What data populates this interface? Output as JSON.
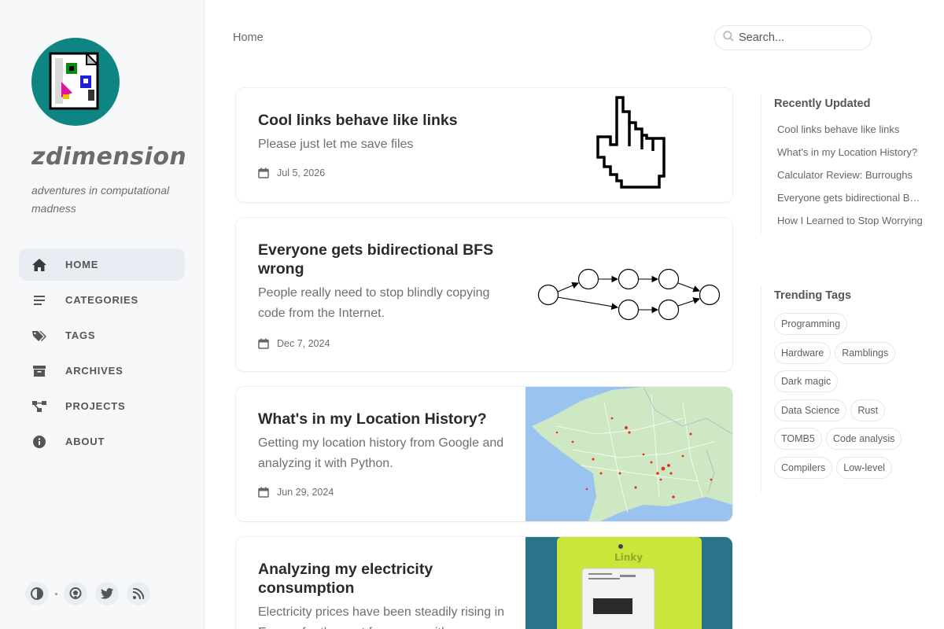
{
  "site": {
    "title": "zdimension",
    "subtitle": "adventures in computational madness"
  },
  "nav": [
    {
      "label": "HOME",
      "icon": "home-icon"
    },
    {
      "label": "CATEGORIES",
      "icon": "list-icon"
    },
    {
      "label": "TAGS",
      "icon": "tags-icon"
    },
    {
      "label": "ARCHIVES",
      "icon": "archive-icon"
    },
    {
      "label": "PROJECTS",
      "icon": "project-diagram-icon"
    },
    {
      "label": "ABOUT",
      "icon": "info-circle-icon"
    }
  ],
  "footer_icons": [
    "theme-toggle-icon",
    "github-icon",
    "twitter-icon",
    "rss-icon"
  ],
  "breadcrumb": "Home",
  "search": {
    "placeholder": "Search..."
  },
  "posts": [
    {
      "title": "Cool links behave like links",
      "desc": "Please just let me save files",
      "date": "Jul 5, 2026"
    },
    {
      "title": "Everyone gets bidirectional BFS wrong",
      "desc": "People really need to stop blindly copying code from the Internet.",
      "date": "Dec 7, 2024"
    },
    {
      "title": "What's in my Location History?",
      "desc": "Getting my location history from Google and analyzing it with Python.",
      "date": "Jun 29, 2024"
    },
    {
      "title": "Analyzing my electricity consumption",
      "desc": "Electricity prices have been steadily rising in Europe for the past few years with",
      "date": "",
      "meter_brand": "Linky"
    }
  ],
  "recently_updated": {
    "title": "Recently Updated",
    "items": [
      "Cool links behave like links",
      "What's in my Location History?",
      "Calculator Review: Burroughs",
      "Everyone gets bidirectional BFS wrong",
      "How I Learned to Stop Worrying"
    ]
  },
  "trending_tags": {
    "title": "Trending Tags",
    "items": [
      "Programming",
      "Hardware",
      "Ramblings",
      "Dark magic",
      "Data Science",
      "Rust",
      "TOMB5",
      "Code analysis",
      "Compilers",
      "Low-level"
    ]
  },
  "colors": {
    "avatar_bg": "#0f8583",
    "map_land": "#cfe8c4",
    "map_sea": "#9bc3f0",
    "meter_body": "#c9e63a"
  }
}
